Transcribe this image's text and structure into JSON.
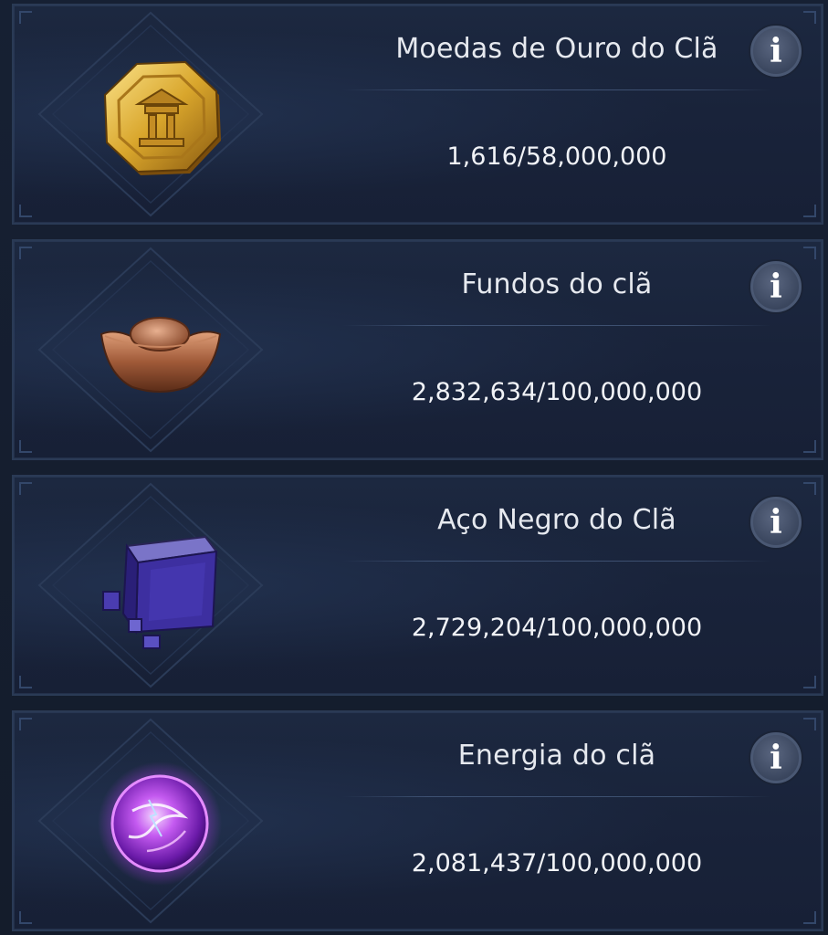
{
  "resources": [
    {
      "icon": "clan-gold-coin-icon",
      "title": "Moedas de Ouro do Clã",
      "value": "1,616/58,000,000",
      "info_glyph": "i"
    },
    {
      "icon": "clan-funds-ingot-icon",
      "title": "Fundos do clã",
      "value": "2,832,634/100,000,000",
      "info_glyph": "i"
    },
    {
      "icon": "clan-black-steel-cube-icon",
      "title": "Aço Negro do Clã",
      "value": "2,729,204/100,000,000",
      "info_glyph": "i"
    },
    {
      "icon": "clan-energy-orb-icon",
      "title": "Energia do clã",
      "value": "2,081,437/100,000,000",
      "info_glyph": "i"
    }
  ],
  "colors": {
    "background": "#141d2c",
    "card": "#1b263d",
    "border": "#2a3a55",
    "text": "#e6e9ef"
  }
}
